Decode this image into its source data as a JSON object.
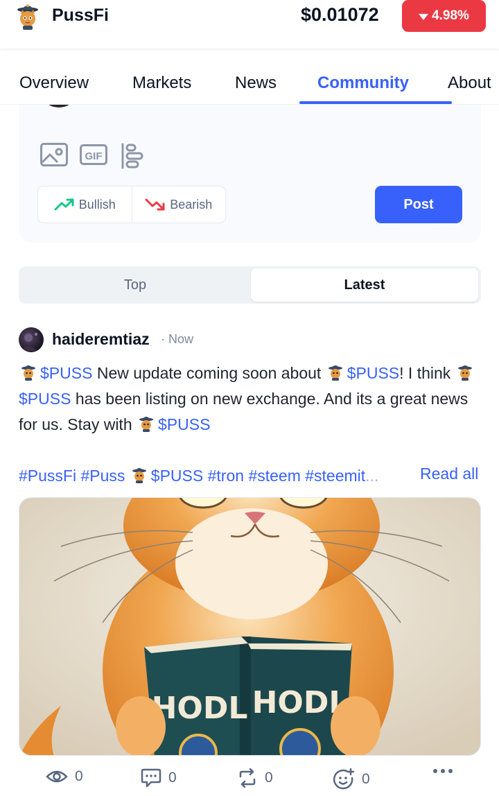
{
  "header": {
    "app_name": "PussFi",
    "price": "$0.01072",
    "change": "4.98%",
    "change_color": "#ea3943"
  },
  "tabs": [
    {
      "label": "Overview",
      "active": false
    },
    {
      "label": "Markets",
      "active": false
    },
    {
      "label": "News",
      "active": false
    },
    {
      "label": "Community",
      "active": true
    },
    {
      "label": "About",
      "active": false
    }
  ],
  "composer": {
    "tools": [
      "image-icon",
      "gif-icon",
      "poll-icon"
    ],
    "bullish_label": "Bullish",
    "bearish_label": "Bearish",
    "post_label": "Post"
  },
  "feed_toggle": {
    "options": [
      "Top",
      "Latest"
    ],
    "selected": "Latest"
  },
  "post": {
    "username": "haideremtiaz",
    "time": "· Now",
    "body": {
      "cash1": "$PUSS",
      "t1": " New update coming soon about ",
      "cash2": "$PUSS",
      "t2": "! I think ",
      "cash3": "$PUSS",
      "t3": " has been listing on new exchange. And its a great news for us. Stay with ",
      "cash4": "$PUSS"
    },
    "hashtags": {
      "a": "#PussFi #Puss ",
      "cash": "$PUSS",
      "b": " #tron #steem #steemit",
      "ellipsis": "..."
    },
    "read_all": "Read all",
    "image_text_left": "HODL",
    "image_text_right": "HODL",
    "stats": {
      "views": "0",
      "comments": "0",
      "reposts": "0",
      "reactions": "0"
    }
  },
  "colors": {
    "accent": "#3861fb",
    "bullish": "#16c784",
    "bearish": "#ea3943"
  }
}
